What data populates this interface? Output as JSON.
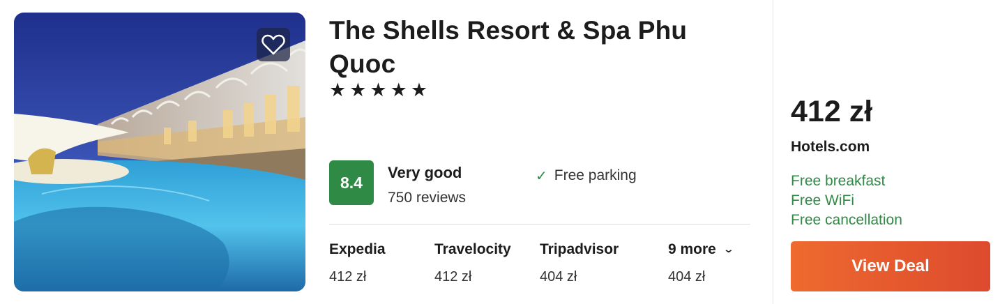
{
  "hotel": {
    "name": "The Shells Resort & Spa Phu Quoc",
    "stars_text": "★★★★★",
    "image_icon": "heart-icon"
  },
  "rating": {
    "score": "8.4",
    "label": "Very good",
    "reviews": "750 reviews",
    "color": "#2f8a46"
  },
  "amenities": [
    {
      "label": "Free parking",
      "icon": "check-icon"
    }
  ],
  "providers": [
    {
      "name": "Expedia",
      "price": "412 zł"
    },
    {
      "name": "Travelocity",
      "price": "412 zł"
    },
    {
      "name": "Tripadvisor",
      "price": "404 zł"
    }
  ],
  "more": {
    "label": "9 more",
    "price": "404 zł",
    "icon": "chevron-down-icon"
  },
  "deal": {
    "price": "412 zł",
    "site": "Hotels.com",
    "perks": [
      "Free breakfast",
      "Free WiFi",
      "Free cancellation"
    ],
    "button": "View Deal",
    "accent": "#e8582e"
  }
}
